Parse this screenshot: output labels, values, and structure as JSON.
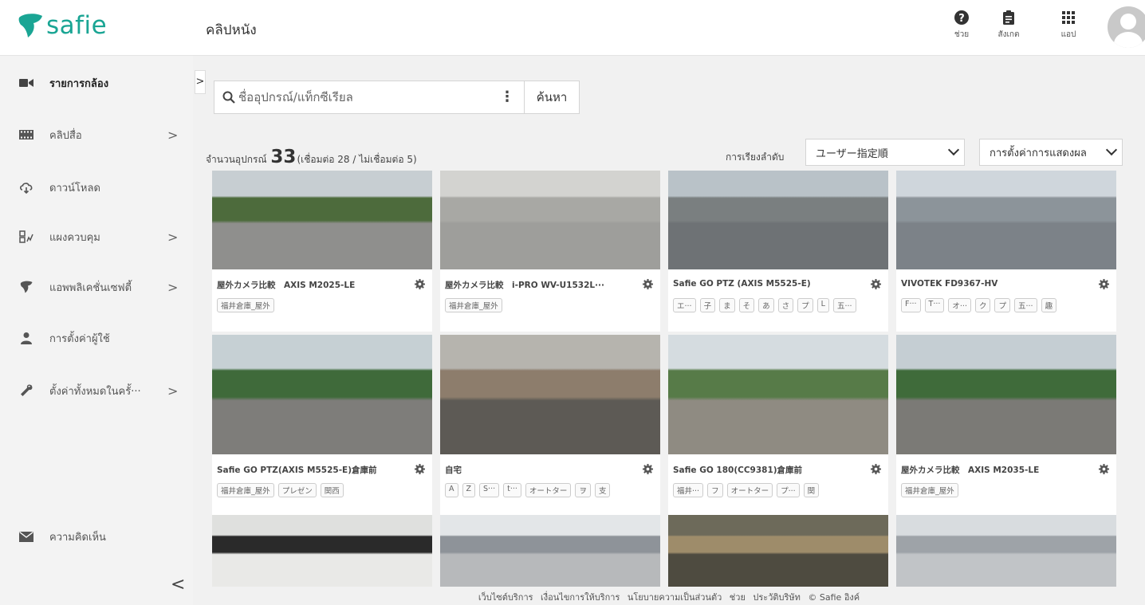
{
  "brand": {
    "name": "safie",
    "color": "#1aa594"
  },
  "header": {
    "title": "คลิปหนัง",
    "actions": [
      {
        "icon": "help-icon",
        "label": "ช่วย"
      },
      {
        "icon": "clipboard-icon",
        "label": "สังเกต"
      },
      {
        "icon": "apps-grid-icon",
        "label": "แอป"
      }
    ]
  },
  "sidebar": {
    "items": [
      {
        "icon": "video-camera-icon",
        "label": "รายการกล้อง",
        "active": true,
        "has_submenu": false
      },
      {
        "icon": "film-icon",
        "label": "คลิปสื่อ",
        "active": false,
        "has_submenu": true
      },
      {
        "icon": "cloud-download-icon",
        "label": "ดาวน์โหลด",
        "active": false,
        "has_submenu": false
      },
      {
        "icon": "dashboard-icon",
        "label": "แผงควบคุม",
        "active": false,
        "has_submenu": true
      },
      {
        "icon": "safie-leaf-icon",
        "label": "แอพพลิเคชั่นเซฟตี้",
        "active": false,
        "has_submenu": true
      },
      {
        "icon": "user-icon",
        "label": "การตั้งค่าผู้ใช้",
        "active": false,
        "has_submenu": false
      },
      {
        "icon": "wrench-icon",
        "label": "ตั้งค่าทั้งหมดในครั้···",
        "active": false,
        "has_submenu": true
      }
    ],
    "feedback": {
      "icon": "mail-icon",
      "label": "ความคิดเห็น"
    },
    "chevron": ">",
    "collapse": "<"
  },
  "toolbar": {
    "expand": ">",
    "search_placeholder": "ชื่ออุปกรณ์/แท็กซีเรียล",
    "more": "⋮",
    "search_button": "ค้นหา",
    "count_prefix": "จำนวนอุปกรณ์",
    "count": "33",
    "count_detail": "(เชื่อมต่อ 28 / ไม่เชื่อมต่อ 5)",
    "sort_label": "การเรียงลำดับ",
    "sort_value": "ユーザー指定順",
    "display_settings": "การตั้งค่าการแสดงผล"
  },
  "cameras": [
    {
      "name": "屋外カメラ比較　AXIS M2025-LE",
      "tags": [
        "福井倉庫_屋外"
      ]
    },
    {
      "name": "屋外カメラ比較　i-PRO WV-U1532L···",
      "tags": [
        "福井倉庫_屋外"
      ]
    },
    {
      "name": "Safie GO PTZ (AXIS M5525-E)",
      "tags": [
        "エ···",
        "子",
        "ま",
        "そ",
        "あ",
        "さ",
        "プ",
        "L",
        "五···"
      ]
    },
    {
      "name": "VIVOTEK FD9367-HV",
      "tags": [
        "F···",
        "T···",
        "オ···",
        "ク",
        "プ",
        "五···",
        "趣"
      ]
    },
    {
      "name": "Safie GO PTZ(AXIS M5525-E)倉庫前",
      "tags": [
        "福井倉庫_屋外",
        "プレゼン",
        "関西"
      ]
    },
    {
      "name": "自宅",
      "tags": [
        "A",
        "Z",
        "S···",
        "t···",
        "オートター",
        "ヲ",
        "支"
      ]
    },
    {
      "name": "Safie GO 180(CC9381)倉庫前",
      "tags": [
        "福井···",
        "フ",
        "オートター",
        "プ···",
        "関"
      ]
    },
    {
      "name": "屋外カメラ比較　AXIS M2035-LE",
      "tags": [
        "福井倉庫_屋外"
      ]
    },
    {
      "name": "",
      "tags": []
    },
    {
      "name": "",
      "tags": []
    },
    {
      "name": "",
      "tags": []
    },
    {
      "name": "",
      "tags": []
    }
  ],
  "footer": {
    "links": [
      "เว็บไซต์บริการ",
      "เงื่อนไขการให้บริการ",
      "นโยบายความเป็นส่วนตัว",
      "ช่วย",
      "ประวัติบริษัท",
      "© Safie อิงค์"
    ]
  }
}
